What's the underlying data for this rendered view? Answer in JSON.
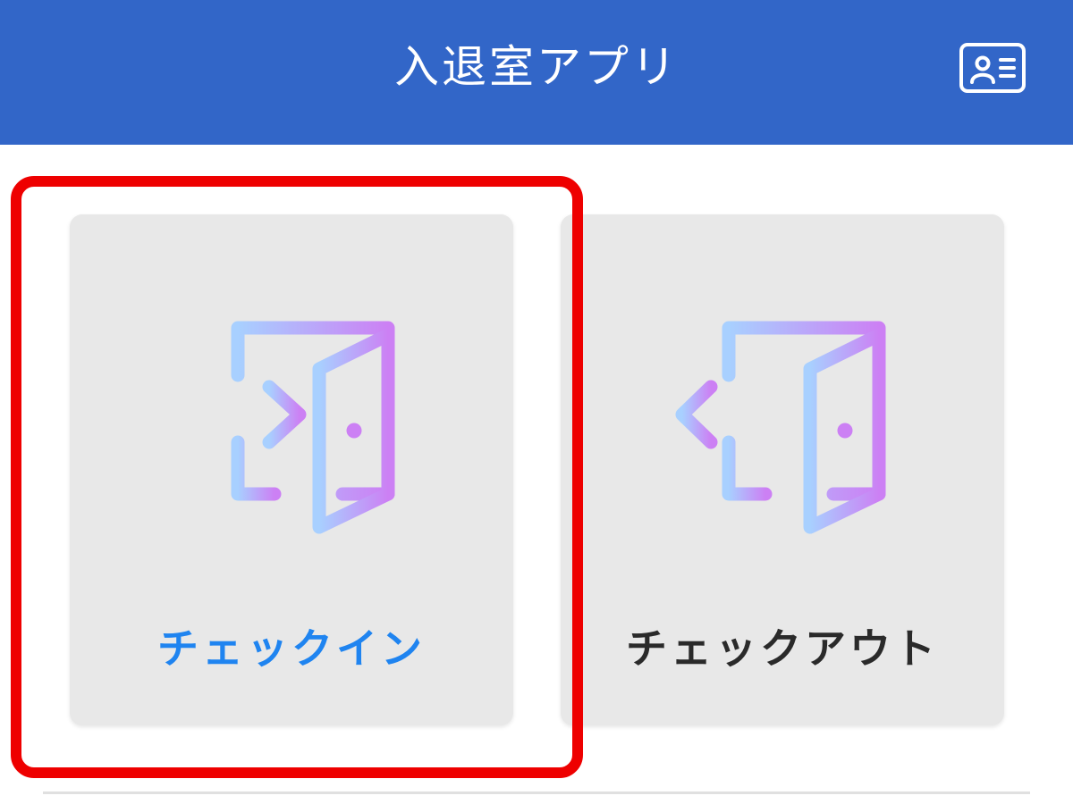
{
  "header": {
    "title": "入退室アプリ",
    "background_color": "#3266c8",
    "right_icon": "id-card-icon"
  },
  "actions": [
    {
      "label": "チェックイン",
      "icon": "door-enter-icon",
      "label_color": "#1f84f0",
      "highlighted": true
    },
    {
      "label": "チェックアウト",
      "icon": "door-exit-icon",
      "label_color": "#2a2a2a",
      "highlighted": false
    }
  ],
  "colors": {
    "icon_gradient_start": "#a8d0ff",
    "icon_gradient_end": "#cc80f4",
    "tile_background": "#e8e8e8",
    "highlight_frame": "#ee0000"
  }
}
